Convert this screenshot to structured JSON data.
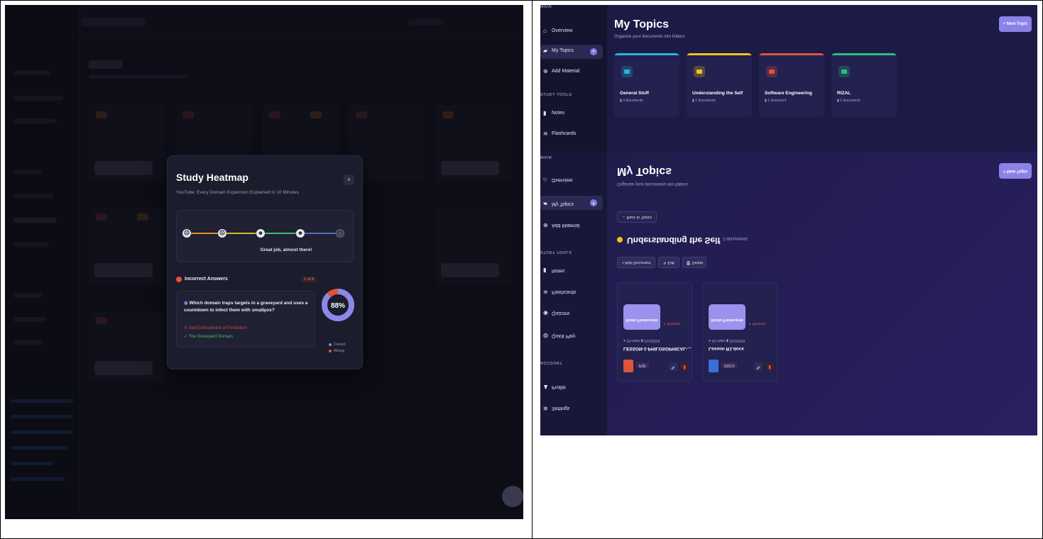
{
  "modal": {
    "title": "Study Heatmap",
    "subtitle": "YouTube: Every Domain Expansion Explained in 10 Minutes",
    "close": "×",
    "progress_message": "Great job, almost there!",
    "incorrect_heading": "Incorrect Answers",
    "incorrect_count": "1 of 8",
    "question": "Which domain traps targets in a graveyard and uses a countdown to infect them with smallpox?",
    "wrong_answer": "Self-Embodiment of Perfection",
    "correct_answer": "The Graveyard Domain",
    "score": "88%",
    "score_fraction": 0.88,
    "legend_correct": "Correct",
    "legend_wrong": "Wrong",
    "colors": {
      "correct": "#8c87e8",
      "wrong": "#e0533a"
    }
  },
  "right": {
    "sidebar_main": "MAIN",
    "sidebar_study": "STUDY TOOLS",
    "sidebar_account": "ACCOUNT",
    "nav": [
      {
        "label": "Overview",
        "icon": "home-icon"
      },
      {
        "label": "My Topics",
        "icon": "folder-icon",
        "badge": "4"
      },
      {
        "label": "Add Material",
        "icon": "plus-circle-icon"
      },
      {
        "label": "Notes",
        "icon": "file-icon"
      },
      {
        "label": "Flashcards",
        "icon": "layers-icon"
      },
      {
        "label": "Quizzes",
        "icon": "help-circle-icon"
      },
      {
        "label": "Quick Play",
        "icon": "gamepad-icon"
      },
      {
        "label": "Profile",
        "icon": "user-icon"
      },
      {
        "label": "Settings",
        "icon": "gear-icon"
      }
    ],
    "title": "My Topics",
    "subtitle": "Organize your documents into folders",
    "new_topic": "+ New Topic",
    "topics": [
      {
        "name": "General Stuff",
        "count": "3 documents",
        "color": "#20b8d8"
      },
      {
        "name": "Understanding the Self",
        "count": "2 documents",
        "color": "#f4c21e"
      },
      {
        "name": "Software Engineering",
        "count": "1 document",
        "color": "#e0533a"
      },
      {
        "name": "RIZAL",
        "count": "2 documents",
        "color": "#2bbf7a"
      }
    ],
    "detail": {
      "back": "← Back to Topics",
      "section_title": "Understanding the Self",
      "section_count": "2 documents",
      "add_doc": "+ Add Document",
      "edit": "✎ Edit",
      "delete": "🗑 Delete",
      "docs": [
        {
          "name": "LESSON-1-PHILOSOPHICAL-...",
          "meta": "● 33 chars  ▮ 2/10/2026",
          "tag": "PDF",
          "study": "Study Flashcards",
          "remove": "✕ Remove",
          "thumb": "#e0533a"
        },
        {
          "name": "Lesson R1.docx",
          "meta": "● 33 chars  ▮ 2/10/2026",
          "tag": "DOCX",
          "study": "Study Flashcards",
          "remove": "✕ Remove",
          "thumb": "#3b6fd8"
        }
      ]
    }
  }
}
